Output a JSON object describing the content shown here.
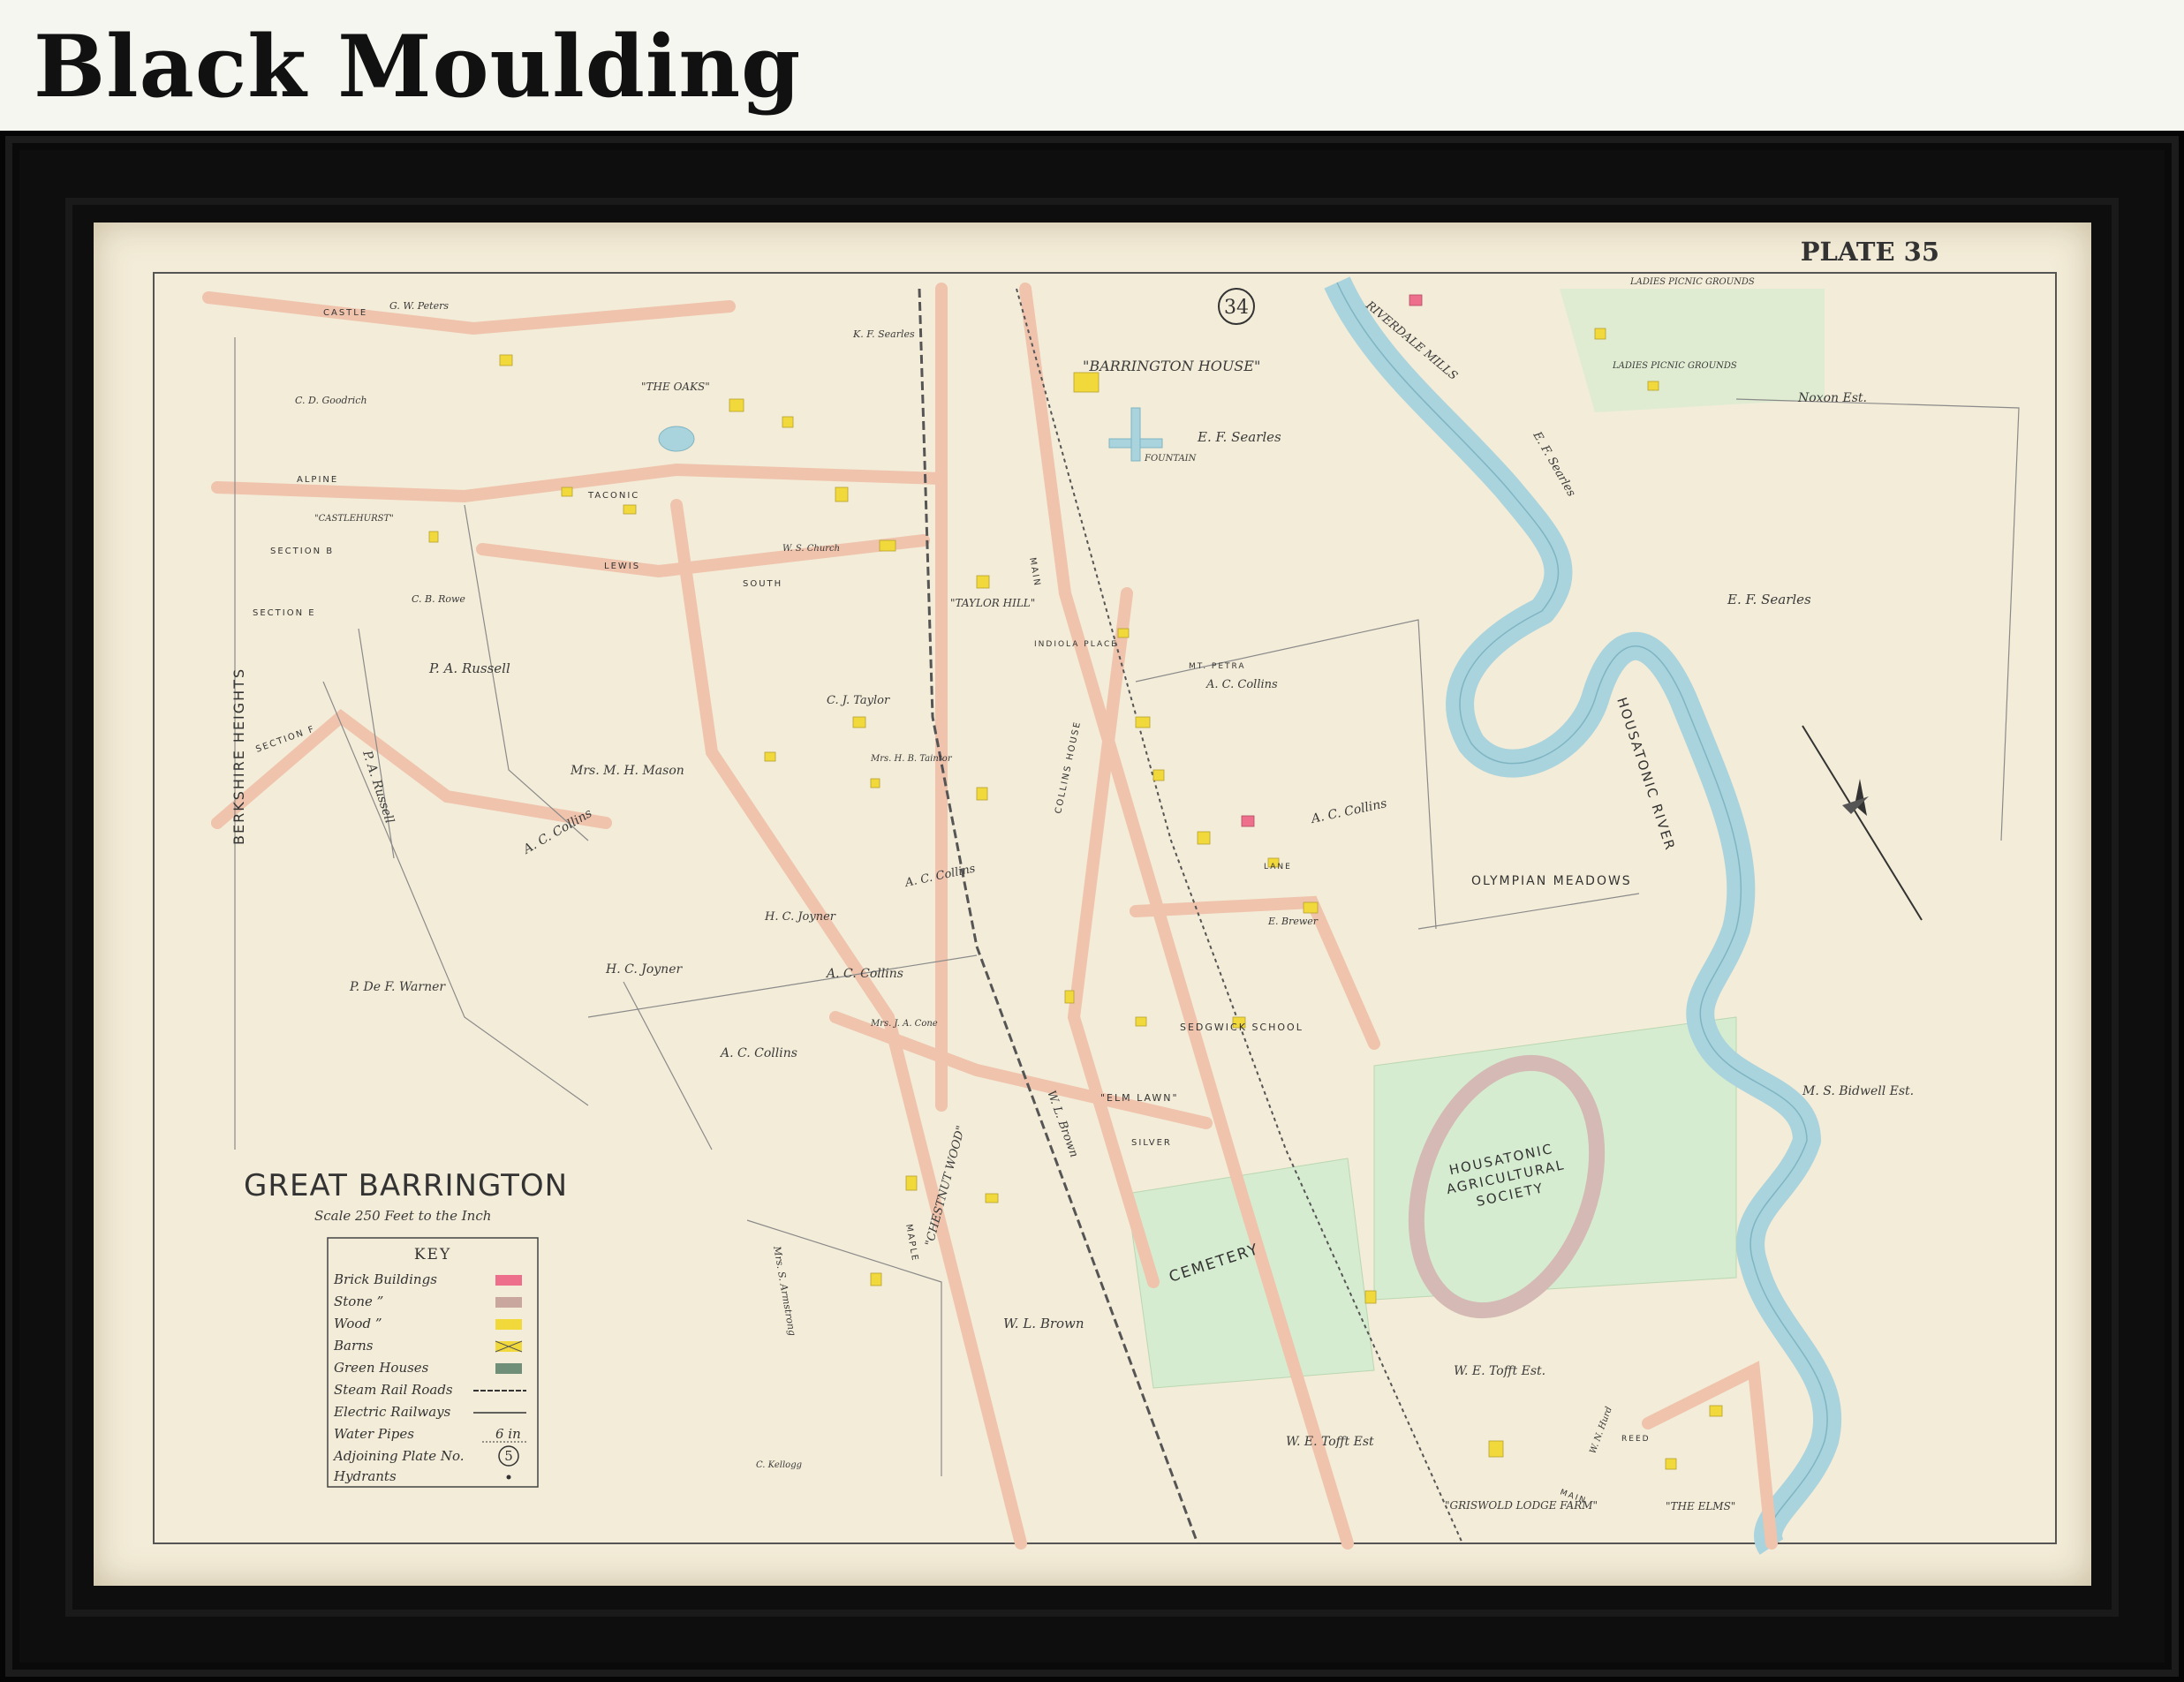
{
  "heading": "Black Moulding",
  "map": {
    "plate": "PLATE 35",
    "plate_ref": "34",
    "town_title": "GREAT BARRINGTON",
    "scale": "Scale 250 Feet to the Inch",
    "colors": {
      "paper": "#f3ecd8",
      "road": "#efc3ac",
      "road_edge": "#d99b85",
      "river": "#a9d3dd",
      "meadow": "#d6ecd0",
      "wood_building": "#f1d93c",
      "brick_building": "#ee6f8b",
      "frame": "#0e0e0e"
    },
    "labels": {
      "barrington_house": "\"BARRINGTON HOUSE\"",
      "ef_searles_1": "E. F. Searles",
      "ef_searles_2": "E. F. Searles",
      "ef_searles_3": "E. F. Searles",
      "fountain": "FOUNTAIN",
      "riverdale_mills": "RIVERDALE MILLS",
      "ladies_picnic_top": "LADIES PICNIC GROUNDS",
      "ladies_picnic": "LADIES PICNIC GROUNDS",
      "noxon": "Noxon Est.",
      "housatonic_river": "HOUSATONIC RIVER",
      "olympian_meadows": "OLYMPIAN MEADOWS",
      "ms_bidwell": "M. S. Bidwell Est.",
      "agricultural_society": [
        "HOUSATONIC",
        "AGRICULTURAL",
        "SOCIETY"
      ],
      "cemetery": "CEMETERY",
      "we_tofft_1": "W. E. Tofft Est.",
      "we_tofft_2": "W. E. Tofft Est",
      "griswold": "\"GRISWOLD LODGE FARM\"",
      "the_elms": "\"THE ELMS\"",
      "wl_brown_1": "W. L. Brown",
      "wl_brown_2": "W. L. Brown",
      "chestnut_wood": "\"CHESTNUT WOOD\"",
      "ac_collins_1": "A. C. Collins",
      "ac_collins_2": "A. C. Collins",
      "ac_collins_3": "A. C. Collins",
      "ac_collins_4": "A. C. Collins",
      "ac_collins_5": "A. C. Collins",
      "ac_collins_6": "A. C. Collins",
      "pa_russell_1": "P. A. Russell",
      "pa_russell_2": "P. A. Russell",
      "mrs_mason": "Mrs. M. H. Mason",
      "hc_joyner_1": "H. C. Joyner",
      "hc_joyner_2": "H. C. Joyner",
      "pde_warner": "P. De F. Warner",
      "cj_taylor": "C. J. Taylor",
      "taylor_hill": "\"TAYLOR HILL\"",
      "mt_petra": "MT. PETRA",
      "sedgwick_school": "SEDGWICK SCHOOL",
      "elm_lawn": "\"ELM LAWN\"",
      "berkshire_heights": "BERKSHIRE HEIGHTS",
      "the_oaks": "\"THE OAKS\"",
      "castle_st": "CASTLE",
      "alpine_st": "ALPINE",
      "taconic_ave": "TACONIC",
      "lewis_ave": "LEWIS",
      "south_st": "SOUTH",
      "main_st": "MAIN",
      "silver_st": "SILVER",
      "maple_ave": "MAPLE",
      "section_e": "SECTION E",
      "section_f": "SECTION F",
      "section_b": "SECTION B",
      "castlehurst": "\"CASTLEHURST\"",
      "cb_rowe": "C. B. Rowe",
      "ed_brewer": "E. Brewer",
      "kt_searles": "K. F. Searles",
      "collins_house": "COLLINS HOUSE",
      "indiola_place": "INDIOLA PLACE",
      "cd_goodrich": "C. D. Goodrich",
      "gw_peters": "G. W. Peters",
      "ws_church": "W. S. Church",
      "mrs_ss_taintor": "Mrs. H. B. Taintor",
      "mrs_jg_cone": "Mrs. J. A. Cone",
      "c_kellogg": "C. Kellogg",
      "mrs_armstrong": "Mrs. S. Armstrong",
      "wn_hurd": "W. N. Hurd",
      "main_st_lower": "MAIN",
      "reed_st": "REED",
      "lane": "LANE"
    },
    "key": {
      "title": "KEY",
      "rows": [
        {
          "label": "Brick Buildings",
          "swatch": "#ee6f8b"
        },
        {
          "label": "Stone ”",
          "swatch": "#c9a79f"
        },
        {
          "label": "Wood ”",
          "swatch": "#f1d93c"
        },
        {
          "label": "Barns",
          "swatch": "#f1d93c"
        },
        {
          "label": "Green Houses",
          "swatch": "#6f8f78"
        },
        {
          "label": "Steam Rail Roads",
          "swatch": ""
        },
        {
          "label": "Electric Railways",
          "swatch": ""
        },
        {
          "label": "Water Pipes",
          "swatch": "",
          "note": "6 in"
        },
        {
          "label": "Adjoining Plate No.",
          "swatch": "",
          "note": "5"
        },
        {
          "label": "Hydrants",
          "swatch": ""
        }
      ]
    }
  }
}
